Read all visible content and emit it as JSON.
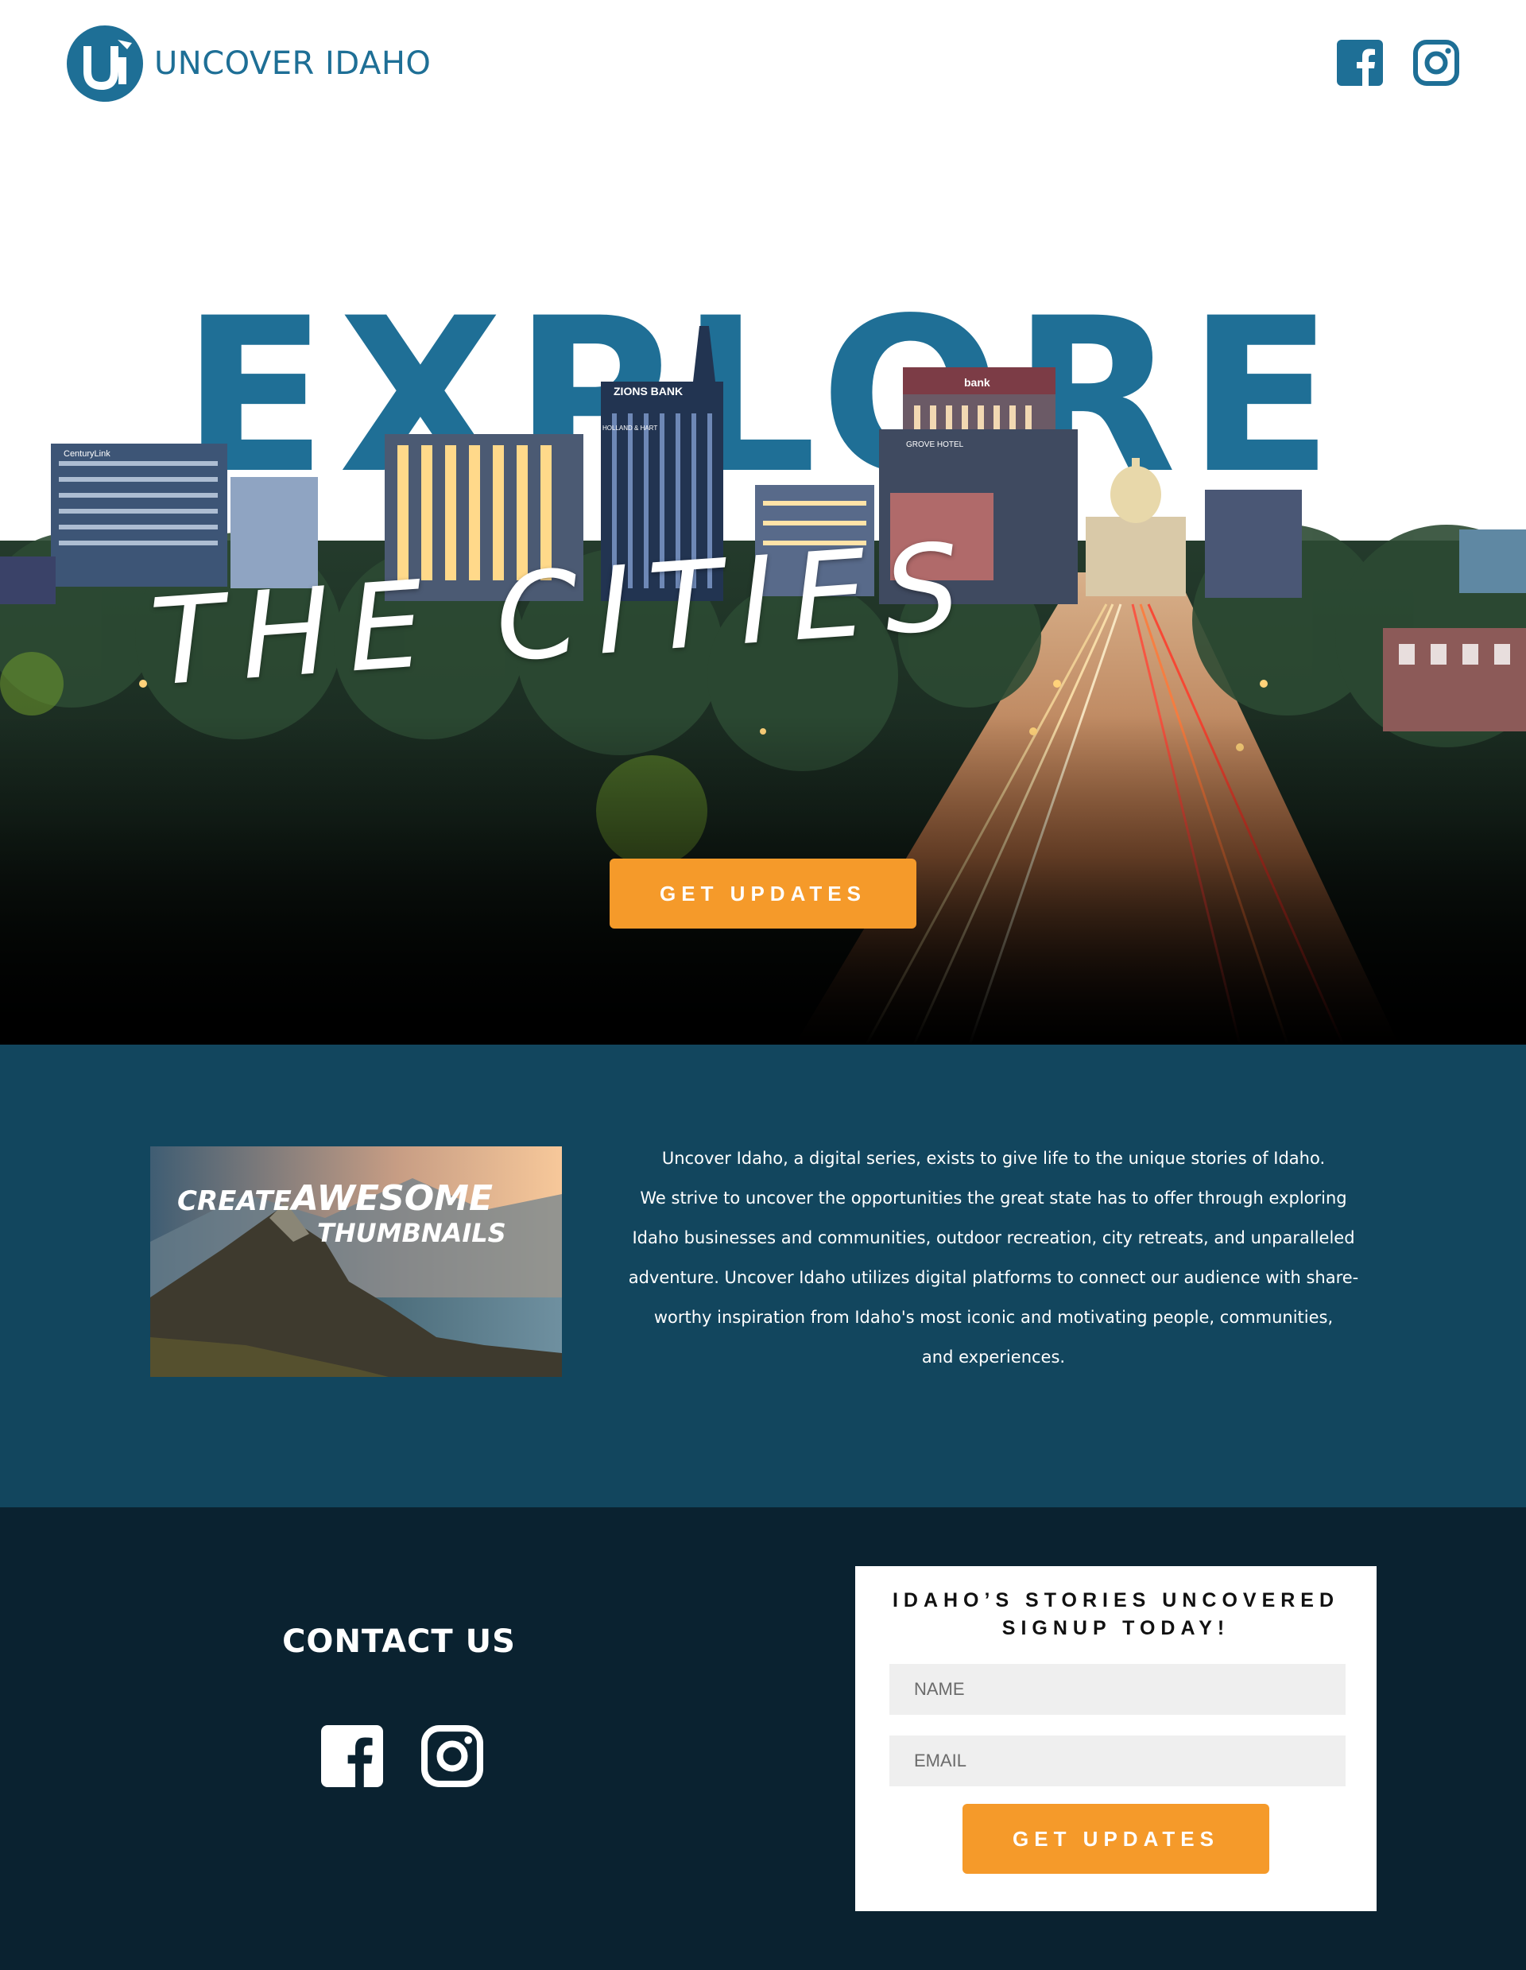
{
  "colors": {
    "brand_blue": "#1e6f96",
    "accent_orange": "#f59a2a",
    "about_bg": "#12465e",
    "footer_bg": "#0a2230"
  },
  "header": {
    "logo_mark_text": "Ui",
    "logo_text": "UNCOVER IDAHO",
    "social_icons": [
      "facebook-icon",
      "instagram-icon"
    ]
  },
  "hero": {
    "headline": "EXPLORE",
    "subheadline": "THE CITIES",
    "button_label": "GET UPDATES",
    "building_signs": [
      "ZIONS BANK",
      "bank",
      "GROVE HOTEL",
      "CenturyLink",
      "HOLLAND & HART"
    ]
  },
  "about": {
    "thumbnail": {
      "line1a": "CREATE",
      "line1b": "AWESOME",
      "line2": "THUMBNAILS"
    },
    "paragraph": [
      "Uncover Idaho, a digital series, exists to give life to the  unique stories of Idaho.",
      "We strive to uncover the opportunities the great state has to offer through exploring",
      "Idaho businesses and communities,  outdoor recreation, city retreats, and unparalleled",
      "adventure. Uncover Idaho utilizes digital platforms to connect our audience with share-",
      "worthy inspiration from Idaho's most iconic and motivating people, communities,",
      "and experiences."
    ]
  },
  "footer": {
    "contact_title": "CONTACT US",
    "social_icons": [
      "facebook-icon",
      "instagram-icon"
    ],
    "signup": {
      "heading_line1": "IDAHO’S STORIES UNCOVERED",
      "heading_line2": "SIGNUP TODAY!",
      "name_placeholder": "NAME",
      "email_placeholder": "EMAIL",
      "button_label": "GET UPDATES"
    }
  }
}
